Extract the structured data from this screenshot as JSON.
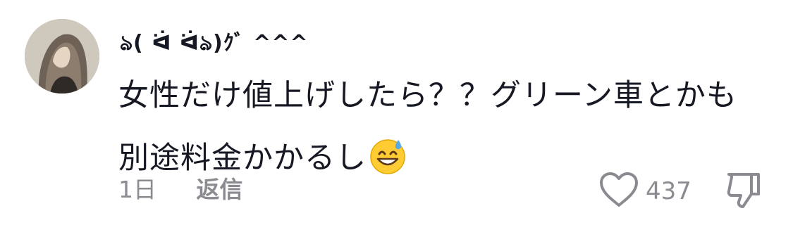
{
  "comment": {
    "username": "ঌ( ᐛ ᐛঌ)ｸﾞ ^^^",
    "text": "女性だけ値上げしたら？？グリーン車とかも別途料金かかるし",
    "emoji": "grinning-face-with-sweat-emoji",
    "time": "1日",
    "reply_label": "返信",
    "like_count": "437"
  },
  "colors": {
    "text_primary": "#161823",
    "text_secondary": "#8a8b91",
    "icon_stroke": "#8a8b91",
    "emoji_face": "#ffcc33",
    "emoji_sweat": "#5aa9e6"
  }
}
